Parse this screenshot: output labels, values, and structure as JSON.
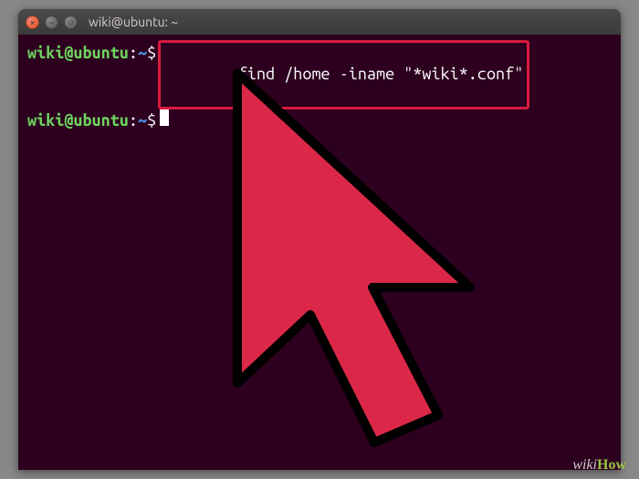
{
  "titlebar": {
    "title": "wiki@ubuntu: ~"
  },
  "prompt": {
    "user_host": "wiki@ubuntu",
    "sep": ":",
    "path": "~",
    "dollar": "$"
  },
  "lines": {
    "command": "find /home -iname \"*wiki*.conf\""
  },
  "watermark": {
    "wiki": "wiki",
    "how": "How"
  },
  "colors": {
    "terminal_bg": "#2c001e",
    "prompt_green": "#6fd35f",
    "highlight_red": "#d81b3e",
    "arrow_fill": "#dc2848",
    "arrow_stroke": "#000000"
  }
}
